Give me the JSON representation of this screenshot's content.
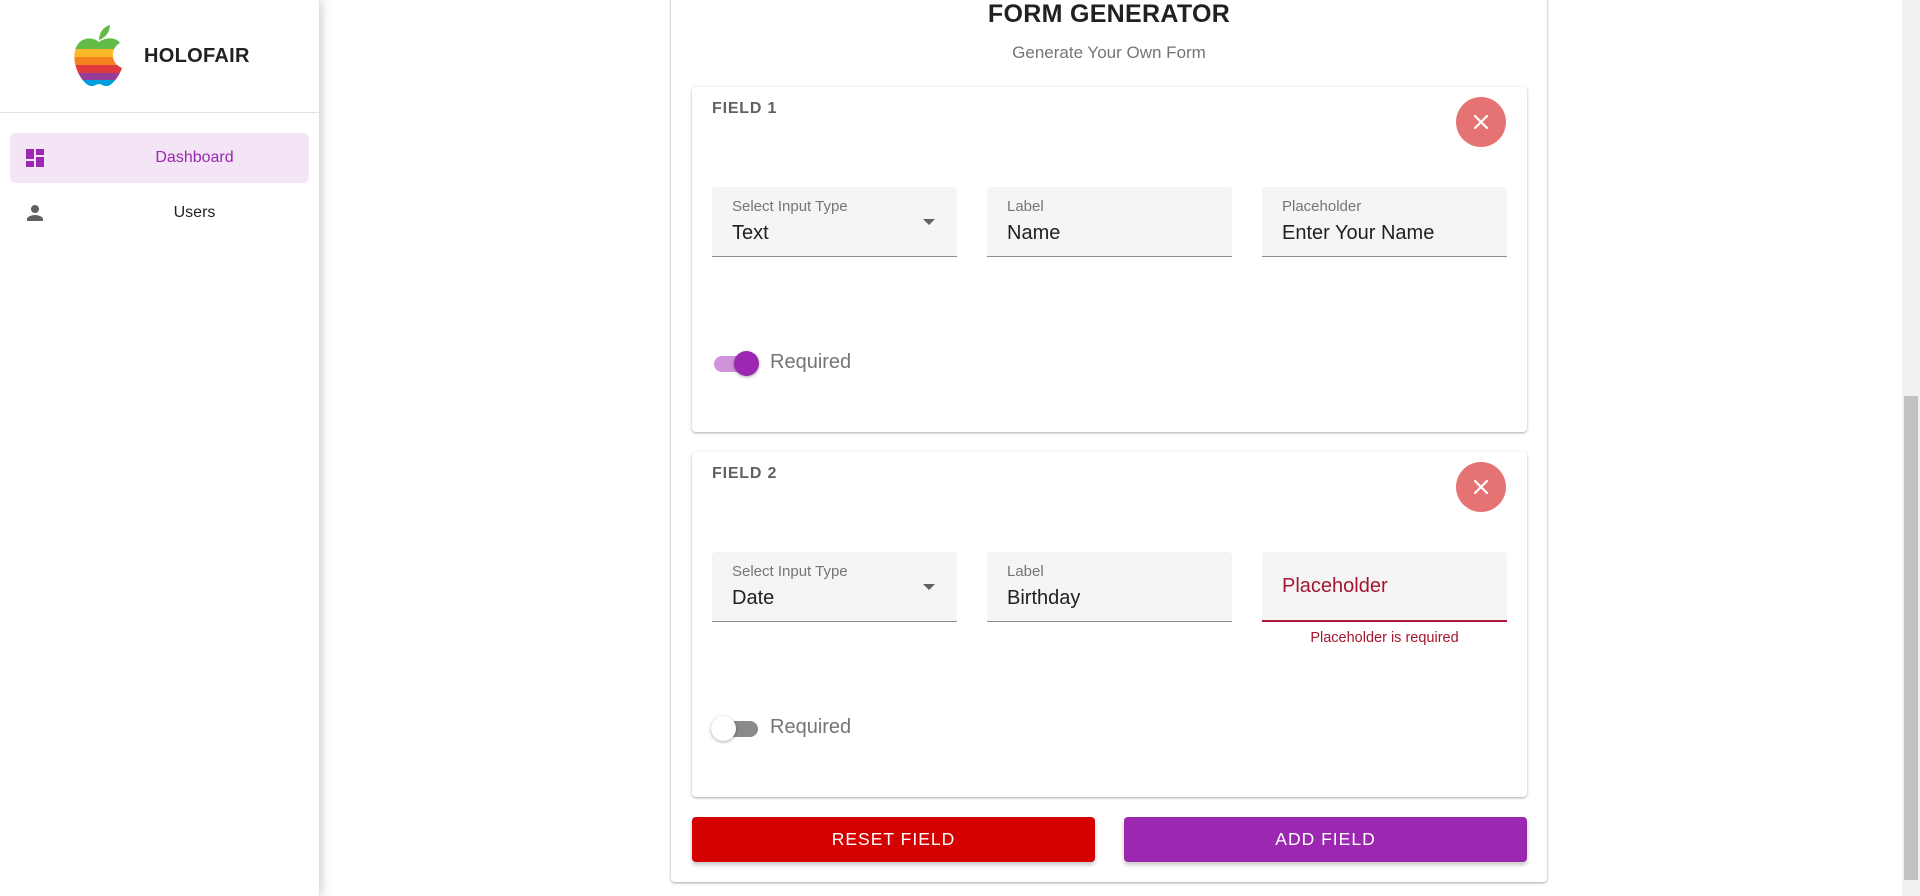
{
  "brand": {
    "name": "HOLOFAIR",
    "logo_colors": [
      "#61bb46",
      "#fdb827",
      "#f5821f",
      "#e03a3e",
      "#963d97",
      "#009ddc"
    ]
  },
  "sidebar": {
    "items": [
      {
        "label": "Dashboard",
        "icon": "dashboard-icon",
        "active": true
      },
      {
        "label": "Users",
        "icon": "person-icon",
        "active": false
      }
    ]
  },
  "form": {
    "title": "FORM GENERATOR",
    "subtitle": "Generate Your Own Form",
    "fields": [
      {
        "title": "FIELD 1",
        "input_type_label": "Select Input Type",
        "input_type_value": "Text",
        "label_label": "Label",
        "label_value": "Name",
        "placeholder_label": "Placeholder",
        "placeholder_value": "Enter Your Name",
        "required_label": "Required",
        "required": true
      },
      {
        "title": "FIELD 2",
        "input_type_label": "Select Input Type",
        "input_type_value": "Date",
        "label_label": "Label",
        "label_value": "Birthday",
        "placeholder_label": "Placeholder",
        "placeholder_value": "",
        "placeholder_error": "Placeholder is required",
        "required_label": "Required",
        "required": false
      }
    ],
    "reset_label": "RESET FIELD",
    "add_label": "ADD FIELD"
  },
  "colors": {
    "accent": "#9c27b0",
    "danger": "#d50000",
    "close": "#e57373",
    "error": "#a4172e"
  }
}
